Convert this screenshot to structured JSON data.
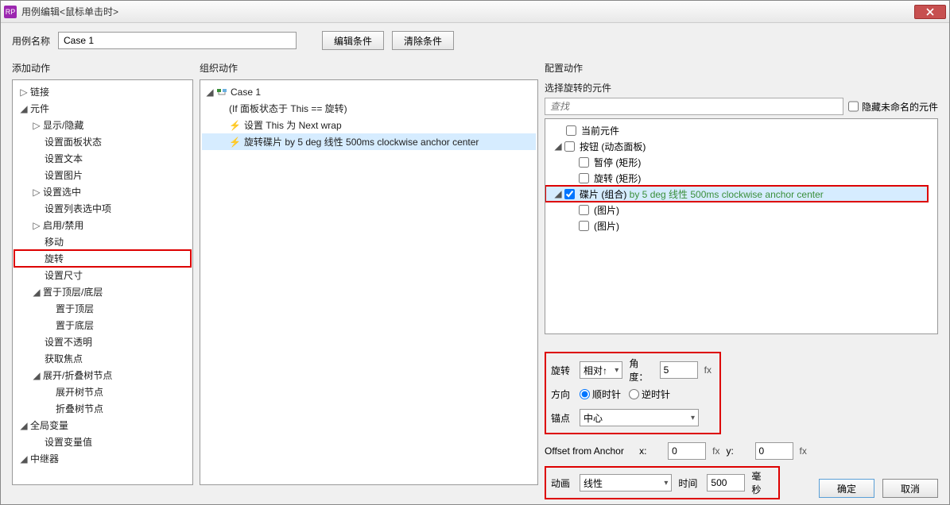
{
  "window": {
    "title": "用例编辑<鼠标单击时>"
  },
  "toprow": {
    "name_label": "用例名称",
    "name_value": "Case 1",
    "edit_cond": "编辑条件",
    "clear_cond": "清除条件"
  },
  "headers": {
    "add_action": "添加动作",
    "org_action": "组织动作",
    "cfg_action": "配置动作"
  },
  "actions_tree": {
    "link": "链接",
    "widget": "元件",
    "show_hide": "显示/隐藏",
    "set_panel": "设置面板状态",
    "set_text": "设置文本",
    "set_image": "设置图片",
    "set_sel": "设置选中",
    "set_list_sel": "设置列表选中项",
    "enable": "启用/禁用",
    "move": "移动",
    "rotate": "旋转",
    "set_size": "设置尺寸",
    "bring": "置于顶层/底层",
    "bring_front": "置于顶层",
    "bring_back": "置于底层",
    "opacity": "设置不透明",
    "focus": "获取焦点",
    "expand": "展开/折叠树节点",
    "expand_n": "展开树节点",
    "collapse_n": "折叠树节点",
    "global": "全局变量",
    "set_var": "设置变量值",
    "repeater": "中继器"
  },
  "org_tree": {
    "case": "Case 1",
    "cond": "(If 面板状态于 This == 旋转)",
    "a1_pre": "设置 ",
    "a1_suf": "This 为 Next wrap",
    "a2_pre": "旋转",
    "a2_mid": "碟片 ",
    "a2_suf": "by 5 deg 线性 500ms clockwise anchor center"
  },
  "right": {
    "select_label": "选择旋转的元件",
    "search_placeholder": "查找",
    "hide_unnamed": "隐藏未命名的元件",
    "items": {
      "current": "当前元件",
      "button": "按钮 (动态面板)",
      "pause": "暂停 (矩形)",
      "rotate_rect": "旋转 (矩形)",
      "disc": "碟片 (组合) ",
      "disc_suffix": "by 5 deg 线性 500ms clockwise anchor center",
      "img1": "(图片)",
      "img2": "(图片)"
    }
  },
  "config": {
    "rotate_label": "旋转",
    "rotate_mode": "相对↑",
    "angle_label": "角度：",
    "angle_value": "5",
    "dir_label": "方向",
    "cw": "顺时针",
    "ccw": "逆时针",
    "anchor_label": "锚点",
    "anchor_value": "中心",
    "offset_label": "Offset from Anchor",
    "x_label": "x:",
    "x_value": "0",
    "y_label": "y:",
    "y_value": "0",
    "anim_label": "动画",
    "anim_value": "线性",
    "time_label": "时间",
    "time_value": "500",
    "time_unit": "毫秒"
  },
  "footer": {
    "ok": "确定",
    "cancel": "取消"
  }
}
